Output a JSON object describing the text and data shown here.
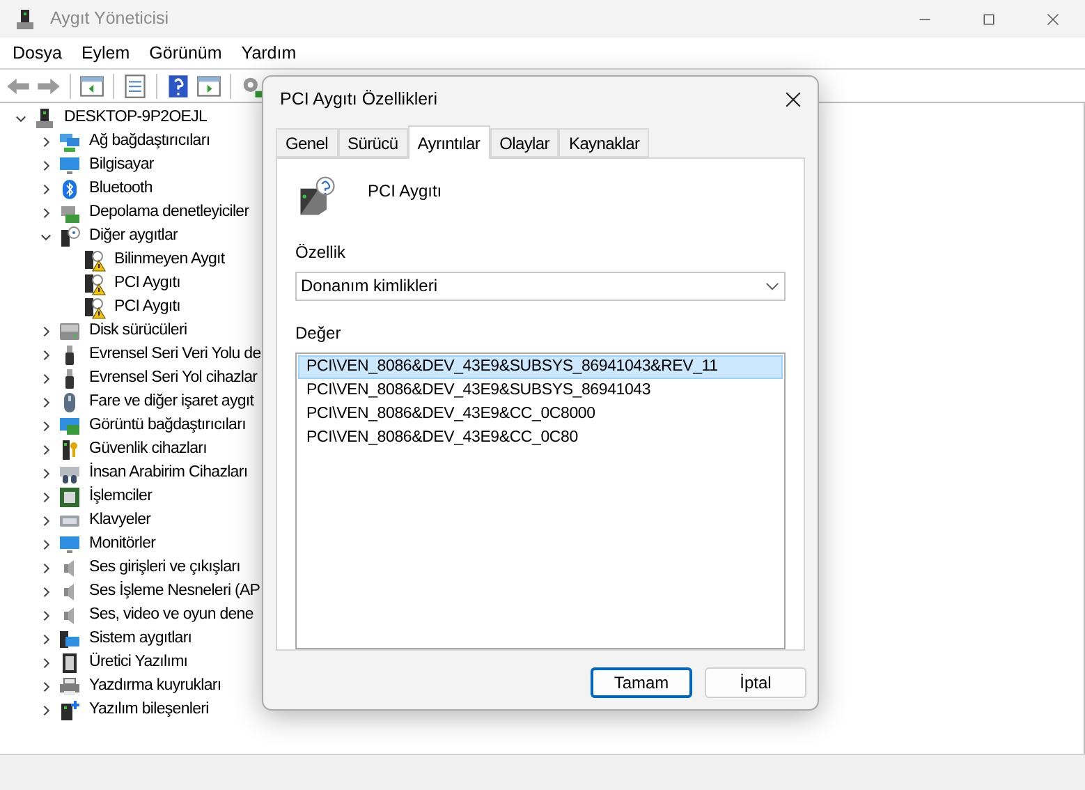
{
  "window": {
    "title": "Aygıt Yöneticisi",
    "active": false
  },
  "menu": [
    "Dosya",
    "Eylem",
    "Görünüm",
    "Yardım"
  ],
  "tree": {
    "label": "DESKTOP-9P2OEJL",
    "expanded": true,
    "children": [
      {
        "label": "Ağ bağdaştırıcıları",
        "expanded": false
      },
      {
        "label": "Bilgisayar",
        "expanded": false
      },
      {
        "label": "Bluetooth",
        "expanded": false
      },
      {
        "label": "Depolama denetleyiciler",
        "expanded": false
      },
      {
        "label": "Diğer aygıtlar",
        "expanded": true,
        "children": [
          {
            "label": "Bilinmeyen Aygıt",
            "warning": true
          },
          {
            "label": "PCI Aygıtı",
            "warning": true
          },
          {
            "label": "PCI Aygıtı",
            "warning": true
          }
        ]
      },
      {
        "label": "Disk sürücüleri",
        "expanded": false
      },
      {
        "label": "Evrensel Seri Veri Yolu de",
        "expanded": false
      },
      {
        "label": "Evrensel Seri Yol cihazlar",
        "expanded": false
      },
      {
        "label": "Fare ve diğer işaret aygıt",
        "expanded": false
      },
      {
        "label": "Görüntü bağdaştırıcıları",
        "expanded": false
      },
      {
        "label": "Güvenlik cihazları",
        "expanded": false
      },
      {
        "label": "İnsan Arabirim Cihazları",
        "expanded": false
      },
      {
        "label": "İşlemciler",
        "expanded": false
      },
      {
        "label": "Klavyeler",
        "expanded": false
      },
      {
        "label": "Monitörler",
        "expanded": false
      },
      {
        "label": "Ses girişleri ve çıkışları",
        "expanded": false
      },
      {
        "label": "Ses İşleme Nesneleri (AP",
        "expanded": false
      },
      {
        "label": "Ses, video ve oyun dene",
        "expanded": false
      },
      {
        "label": "Sistem aygıtları",
        "expanded": false
      },
      {
        "label": "Üretici Yazılımı",
        "expanded": false
      },
      {
        "label": "Yazdırma kuyrukları",
        "expanded": false
      },
      {
        "label": "Yazılım bileşenleri",
        "expanded": false
      }
    ]
  },
  "dialog": {
    "title": "PCI Aygıtı Özellikleri",
    "tabs": [
      {
        "label": "Genel",
        "selected": false
      },
      {
        "label": "Sürücü",
        "selected": false
      },
      {
        "label": "Ayrıntılar",
        "selected": true
      },
      {
        "label": "Olaylar",
        "selected": false
      },
      {
        "label": "Kaynaklar",
        "selected": false
      }
    ],
    "device_name": "PCI Aygıtı",
    "property_label": "Özellik",
    "property_value": "Donanım kimlikleri",
    "value_label": "Değer",
    "values": [
      {
        "text": "PCI\\VEN_8086&DEV_43E9&SUBSYS_86941043&REV_11",
        "selected": true
      },
      {
        "text": "PCI\\VEN_8086&DEV_43E9&SUBSYS_86941043",
        "selected": false
      },
      {
        "text": "PCI\\VEN_8086&DEV_43E9&CC_0C8000",
        "selected": false
      },
      {
        "text": "PCI\\VEN_8086&DEV_43E9&CC_0C80",
        "selected": false
      }
    ],
    "buttons": [
      {
        "label": "Tamam",
        "default": true
      },
      {
        "label": "İptal",
        "default": false
      }
    ]
  }
}
